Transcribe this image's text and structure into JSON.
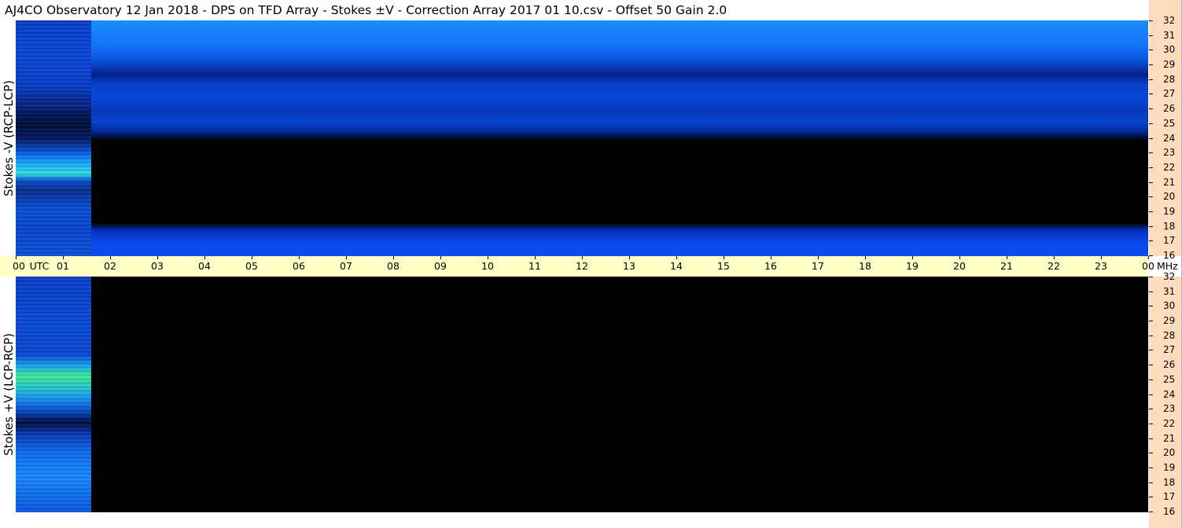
{
  "title": "AJ4CO Observatory  12 Jan 2018  -  DPS on TFD Array  -  Stokes ±V  -  Correction Array 2017 01 10.csv  -  Offset 50  Gain 2.0",
  "chart_data": [
    {
      "type": "heatmap",
      "ylabel": "Stokes -V (RCP-LCP)",
      "y_unit": "MHz",
      "ylim": [
        16,
        32
      ],
      "yticks": [
        "32",
        "31",
        "30",
        "29",
        "28",
        "27",
        "26",
        "25",
        "24",
        "23",
        "22",
        "21",
        "20",
        "19",
        "18",
        "17",
        "16"
      ],
      "x_unit": "UTC",
      "xticks": [
        "00",
        "01",
        "02",
        "03",
        "04",
        "05",
        "06",
        "07",
        "08",
        "09",
        "10",
        "11",
        "12",
        "13",
        "14",
        "15",
        "16",
        "17",
        "18",
        "19",
        "20",
        "21",
        "22",
        "23",
        "00"
      ],
      "data_end_hour": 1.6
    },
    {
      "type": "heatmap",
      "ylabel": "Stokes +V (LCP-RCP)",
      "y_unit": "MHz",
      "ylim": [
        16,
        32
      ],
      "yticks": [
        "32",
        "31",
        "30",
        "29",
        "28",
        "27",
        "26",
        "25",
        "24",
        "23",
        "22",
        "21",
        "20",
        "19",
        "18",
        "17",
        "16"
      ],
      "x_unit": "UTC",
      "xticks": [
        "00",
        "01",
        "02",
        "03",
        "04",
        "05",
        "06",
        "07",
        "08",
        "09",
        "10",
        "11",
        "12",
        "13",
        "14",
        "15",
        "16",
        "17",
        "18",
        "19",
        "20",
        "21",
        "22",
        "23",
        "00"
      ],
      "data_end_hour": 1.6
    }
  ],
  "time_axis": {
    "utc_label": "UTC",
    "unit_label": "MHz"
  },
  "colors": {
    "scale_bg": "#ffdcbd",
    "time_axis_bg": "#ffffc6",
    "blue_bright": "#1c8cff",
    "blue_mid": "#0a48e0",
    "blue_dark": "#021a78",
    "signal_green": "#33ee88"
  }
}
